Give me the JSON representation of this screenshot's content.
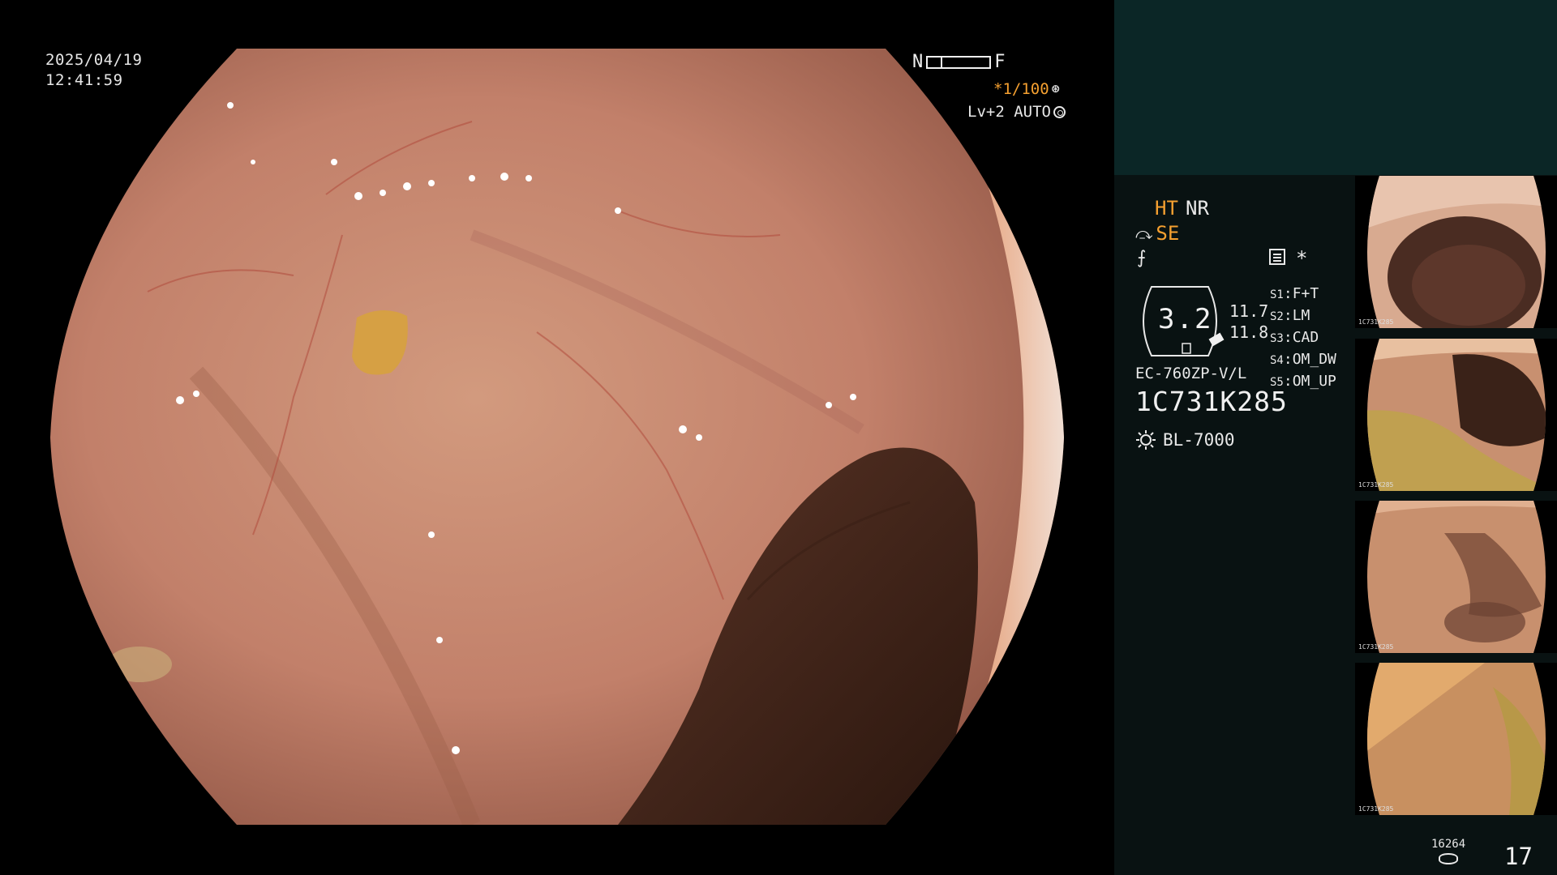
{
  "overlay": {
    "date": "2025/04/19",
    "time": "12:41:59",
    "nf_near": "N",
    "nf_far": "F",
    "shutter": "*1/100",
    "iris": "Lv+2 AUTO"
  },
  "panel": {
    "mode_ht": "HT",
    "mode_nr": "NR",
    "enhancement": "SE",
    "asterisk": "*",
    "gauge_value": "3.2",
    "gauge_v1": "11.7",
    "gauge_v2": "11.8",
    "scope_model": "EC-760ZP-V/L",
    "serial": "1C731K285",
    "light_source": "BL-7000",
    "switches": [
      {
        "key": "S1",
        "label": "F+T"
      },
      {
        "key": "S2",
        "label": "LM"
      },
      {
        "key": "S3",
        "label": "CAD"
      },
      {
        "key": "S4",
        "label": "OM_DW"
      },
      {
        "key": "S5",
        "label": "OM_UP"
      }
    ]
  },
  "thumbnails": [
    {
      "label": "1C731K285"
    },
    {
      "label": "1C731K285"
    },
    {
      "label": "1C731K285"
    },
    {
      "label": "1C731K285"
    }
  ],
  "footer": {
    "image_count": "16264",
    "page_number": "17"
  },
  "colors": {
    "accent_orange": "#f5a030",
    "panel_bg": "#091212",
    "panel_top_bg": "#0b2626",
    "tissue": "#c98a6a"
  },
  "icons": [
    "fan-icon",
    "iris-icon",
    "enhancement-icon",
    "structure-icon",
    "memo-icon",
    "light-source-icon",
    "disk-icon"
  ]
}
